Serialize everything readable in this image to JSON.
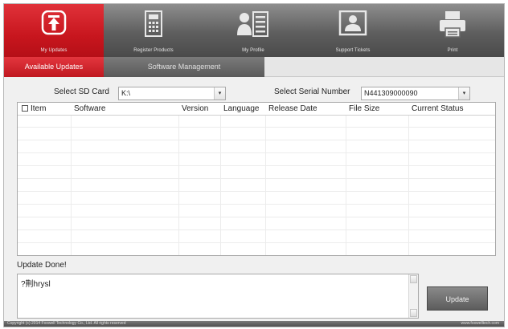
{
  "nav": {
    "items": [
      {
        "label": "My Updates",
        "icon": "upload-icon",
        "active": true
      },
      {
        "label": "Register Products",
        "icon": "register-icon",
        "active": false
      },
      {
        "label": "My Profile",
        "icon": "profile-icon",
        "active": false
      },
      {
        "label": "Support Tickets",
        "icon": "support-icon",
        "active": false
      },
      {
        "label": "Print",
        "icon": "printer-icon",
        "active": false
      }
    ]
  },
  "tabs": [
    {
      "label": "Available Updates",
      "active": true
    },
    {
      "label": "Software Management",
      "active": false
    }
  ],
  "sd_card": {
    "label": "Select SD Card",
    "value": "K:\\"
  },
  "serial": {
    "label": "Select Serial Number",
    "value": "N441309000090"
  },
  "table": {
    "columns": [
      "Item",
      "Software",
      "Version",
      "Language",
      "Release Date",
      "File Size",
      "Current Status"
    ],
    "rows": []
  },
  "status_text": "Update Done!",
  "log_text": "?荆hrysl",
  "update_button": "Update",
  "footer": {
    "copyright": "Copyright (c) 2014 Foxwell Technology Co., Ltd. All rights reserved",
    "website": "www.foxwelltech.com"
  },
  "colors": {
    "accent": "#c8161e",
    "nav_bg": "#5e5e5e"
  }
}
